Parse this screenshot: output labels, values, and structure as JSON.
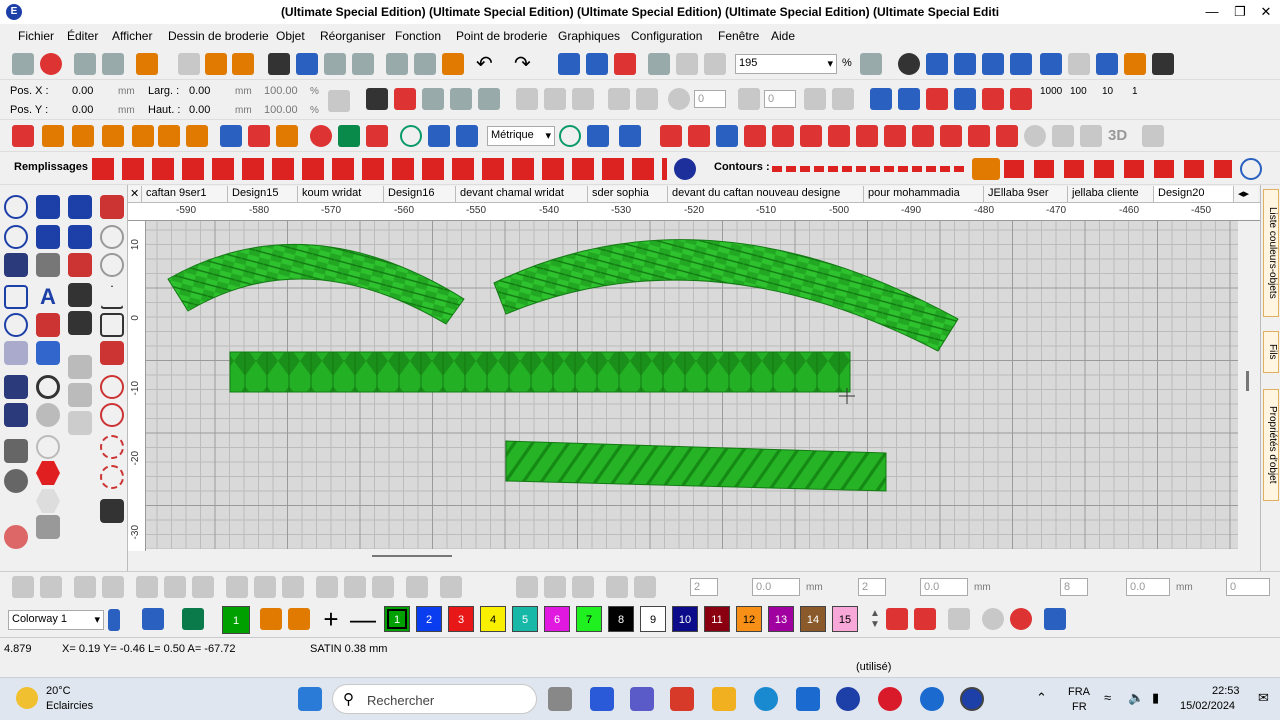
{
  "window": {
    "title": "(Ultimate Special Edition) (Ultimate Special Edition) (Ultimate Special Edition) (Ultimate Special Edition) (Ultimate Special Editi"
  },
  "menu": [
    "Fichier",
    "Éditer",
    "Afficher",
    "Dessin de broderie",
    "Objet",
    "Réorganiser",
    "Fonction",
    "Point de broderie",
    "Graphiques",
    "Configuration",
    "Fenêtre",
    "Aide"
  ],
  "position": {
    "posx_label": "Pos. X :",
    "posx_value": "0.00",
    "posy_label": "Pos. Y :",
    "posy_value": "0.00",
    "larg_label": "Larg. :",
    "larg_value": "0.00",
    "haut_label": "Haut. :",
    "haut_value": "0.00",
    "unit_mm": "mm",
    "unit_pct": "%",
    "scale_w": "100.00",
    "scale_h": "100.00"
  },
  "zoom": {
    "value": "195",
    "unit": "%"
  },
  "spin": {
    "rot1": "0",
    "rot2": "0"
  },
  "units_select": "Métrique",
  "fill_label": "Remplissages :",
  "contour_label": "Contours :",
  "tabs": [
    "caftan 9ser1",
    "Design15",
    "koum wridat",
    "Design16",
    "devant chamal wridat",
    "sder sophia",
    "devant du caftan nouveau designe",
    "pour mohammadia",
    "JEllaba 9ser",
    "jellaba cliente",
    "Design20"
  ],
  "hruler": [
    "-590",
    "-580",
    "-570",
    "-560",
    "-550",
    "-540",
    "-530",
    "-520",
    "-510",
    "-500",
    "-490",
    "-480",
    "-470",
    "-460",
    "-450"
  ],
  "vruler": [
    "10",
    "0",
    "-10",
    "-20",
    "-30"
  ],
  "right_tabs": [
    "Liste couleurs-objets",
    "Fils",
    "Propriétés d'objet"
  ],
  "bottom_fields": {
    "v1": "2",
    "v2": "0.0",
    "mm1": "mm",
    "v3": "2",
    "v4": "0.0",
    "mm2": "mm",
    "v5": "8",
    "v6": "0.0",
    "mm3": "mm",
    "v7": "0"
  },
  "colorway": "Colorway 1",
  "current_color": "1",
  "swatches": [
    {
      "n": "1",
      "c": "#00a000"
    },
    {
      "n": "2",
      "c": "#0a3cf0"
    },
    {
      "n": "3",
      "c": "#e81818"
    },
    {
      "n": "4",
      "c": "#f8f000"
    },
    {
      "n": "5",
      "c": "#18b8a8"
    },
    {
      "n": "6",
      "c": "#e018e0"
    },
    {
      "n": "7",
      "c": "#20f020"
    },
    {
      "n": "8",
      "c": "#000000"
    },
    {
      "n": "9",
      "c": "#ffffff"
    },
    {
      "n": "10",
      "c": "#0c0c8a"
    },
    {
      "n": "11",
      "c": "#8a0010"
    },
    {
      "n": "12",
      "c": "#f89018"
    },
    {
      "n": "13",
      "c": "#a000a0"
    },
    {
      "n": "14",
      "c": "#8a5a2a"
    },
    {
      "n": "15",
      "c": "#f8a8d8"
    }
  ],
  "status": {
    "left": "4.879",
    "coords": "X=  0.19 Y=  -0.46 L=  0.50 A= -67.72",
    "stitch": "SATIN  0.38 mm",
    "used": "(utilisé)"
  },
  "taskbar": {
    "temp": "20°C",
    "weather": "Eclaircies",
    "search": "Rechercher",
    "lang1": "FRA",
    "lang2": "FR",
    "time": "22:53",
    "date": "15/02/2024"
  },
  "colors": {
    "embroidery": "#22a822",
    "embroidery_dark": "#137a13",
    "accent": "#1d3fa8"
  }
}
